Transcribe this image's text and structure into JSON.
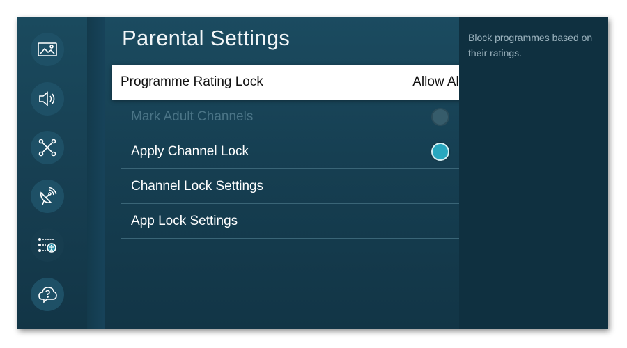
{
  "page": {
    "title": "Parental Settings",
    "description": "Block programmes based on their ratings."
  },
  "sidebar": {
    "icons": [
      {
        "name": "picture-icon"
      },
      {
        "name": "sound-icon"
      },
      {
        "name": "connection-icon"
      },
      {
        "name": "broadcasting-icon"
      },
      {
        "name": "general-settings-icon",
        "active": true
      },
      {
        "name": "support-icon"
      }
    ]
  },
  "menu": {
    "items": [
      {
        "label": "Programme Rating Lock",
        "value": "Allow All",
        "focused": true
      },
      {
        "label": "Mark Adult Channels",
        "toggle": "off",
        "disabled": true
      },
      {
        "label": "Apply Channel Lock",
        "toggle": "on"
      },
      {
        "label": "Channel Lock Settings"
      },
      {
        "label": "App Lock Settings"
      }
    ]
  },
  "colors": {
    "accent_toggle_on": "#28a7bf",
    "focus_background": "#ffffff",
    "panel_background": "#123546"
  }
}
